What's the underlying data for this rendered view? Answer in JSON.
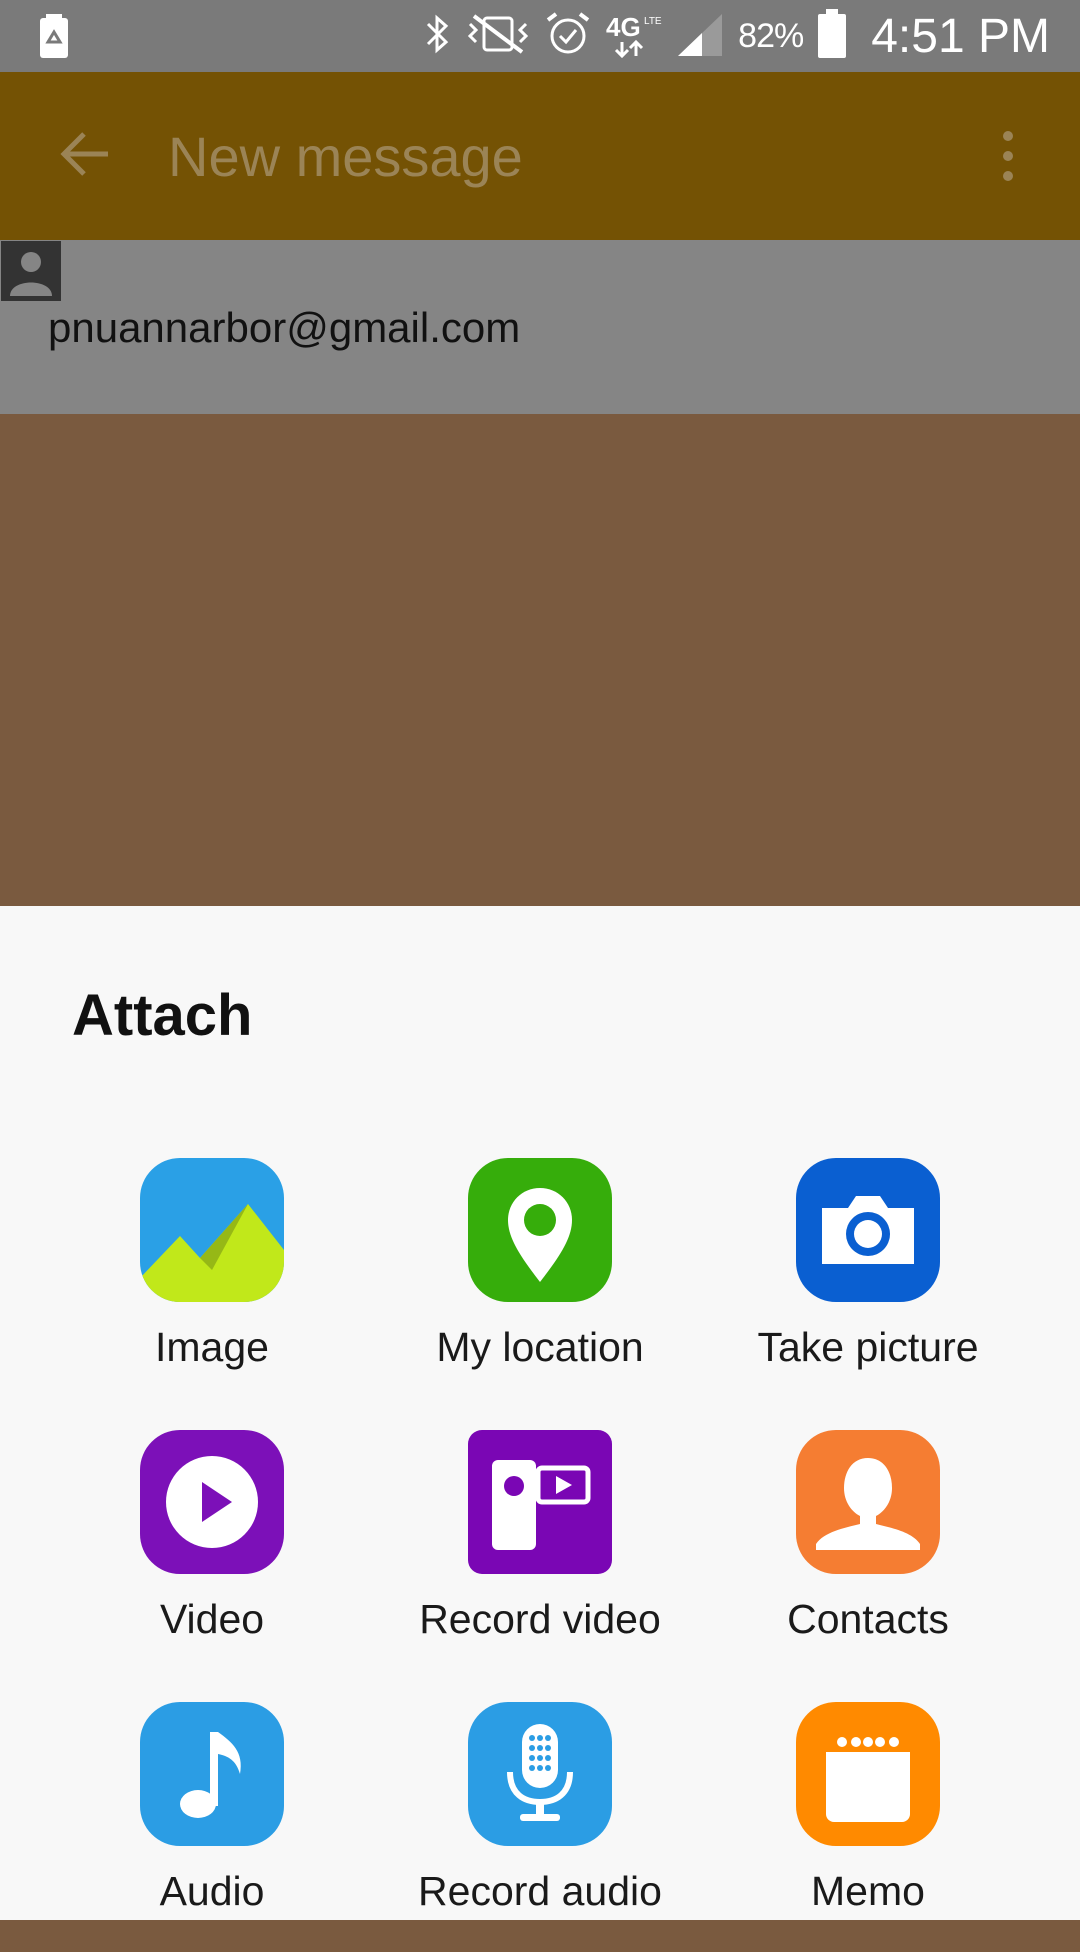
{
  "status_bar": {
    "battery_percent": "82%",
    "time": "4:51 PM",
    "icons": [
      "battery-saver-icon",
      "bluetooth-icon",
      "vibrate-mute-icon",
      "alarm-icon",
      "4g-lte-icon",
      "signal-icon",
      "battery-icon"
    ]
  },
  "toolbar": {
    "back_icon": "arrow-left-icon",
    "title": "New message",
    "more_icon": "more-vertical-icon"
  },
  "recipient": {
    "address": "pnuannarbor@gmail.com",
    "contact_icon": "contact-picker-icon"
  },
  "attach_sheet": {
    "title": "Attach",
    "items": [
      {
        "label": "Image",
        "icon": "image-icon",
        "color": "#2aa0e6"
      },
      {
        "label": "My location",
        "icon": "location-pin-icon",
        "color": "#36ad0b"
      },
      {
        "label": "Take picture",
        "icon": "camera-icon",
        "color": "#0a5fd1"
      },
      {
        "label": "Video",
        "icon": "video-play-icon",
        "color": "#7c10b8"
      },
      {
        "label": "Record video",
        "icon": "video-camera-icon",
        "color": "#7a06b4"
      },
      {
        "label": "Contacts",
        "icon": "contact-person-icon",
        "color": "#f57d32"
      },
      {
        "label": "Audio",
        "icon": "music-note-icon",
        "color": "#2b9de4"
      },
      {
        "label": "Record audio",
        "icon": "microphone-icon",
        "color": "#2b9de4"
      },
      {
        "label": "Memo",
        "icon": "memo-icon",
        "color": "#ff8a00"
      }
    ]
  }
}
